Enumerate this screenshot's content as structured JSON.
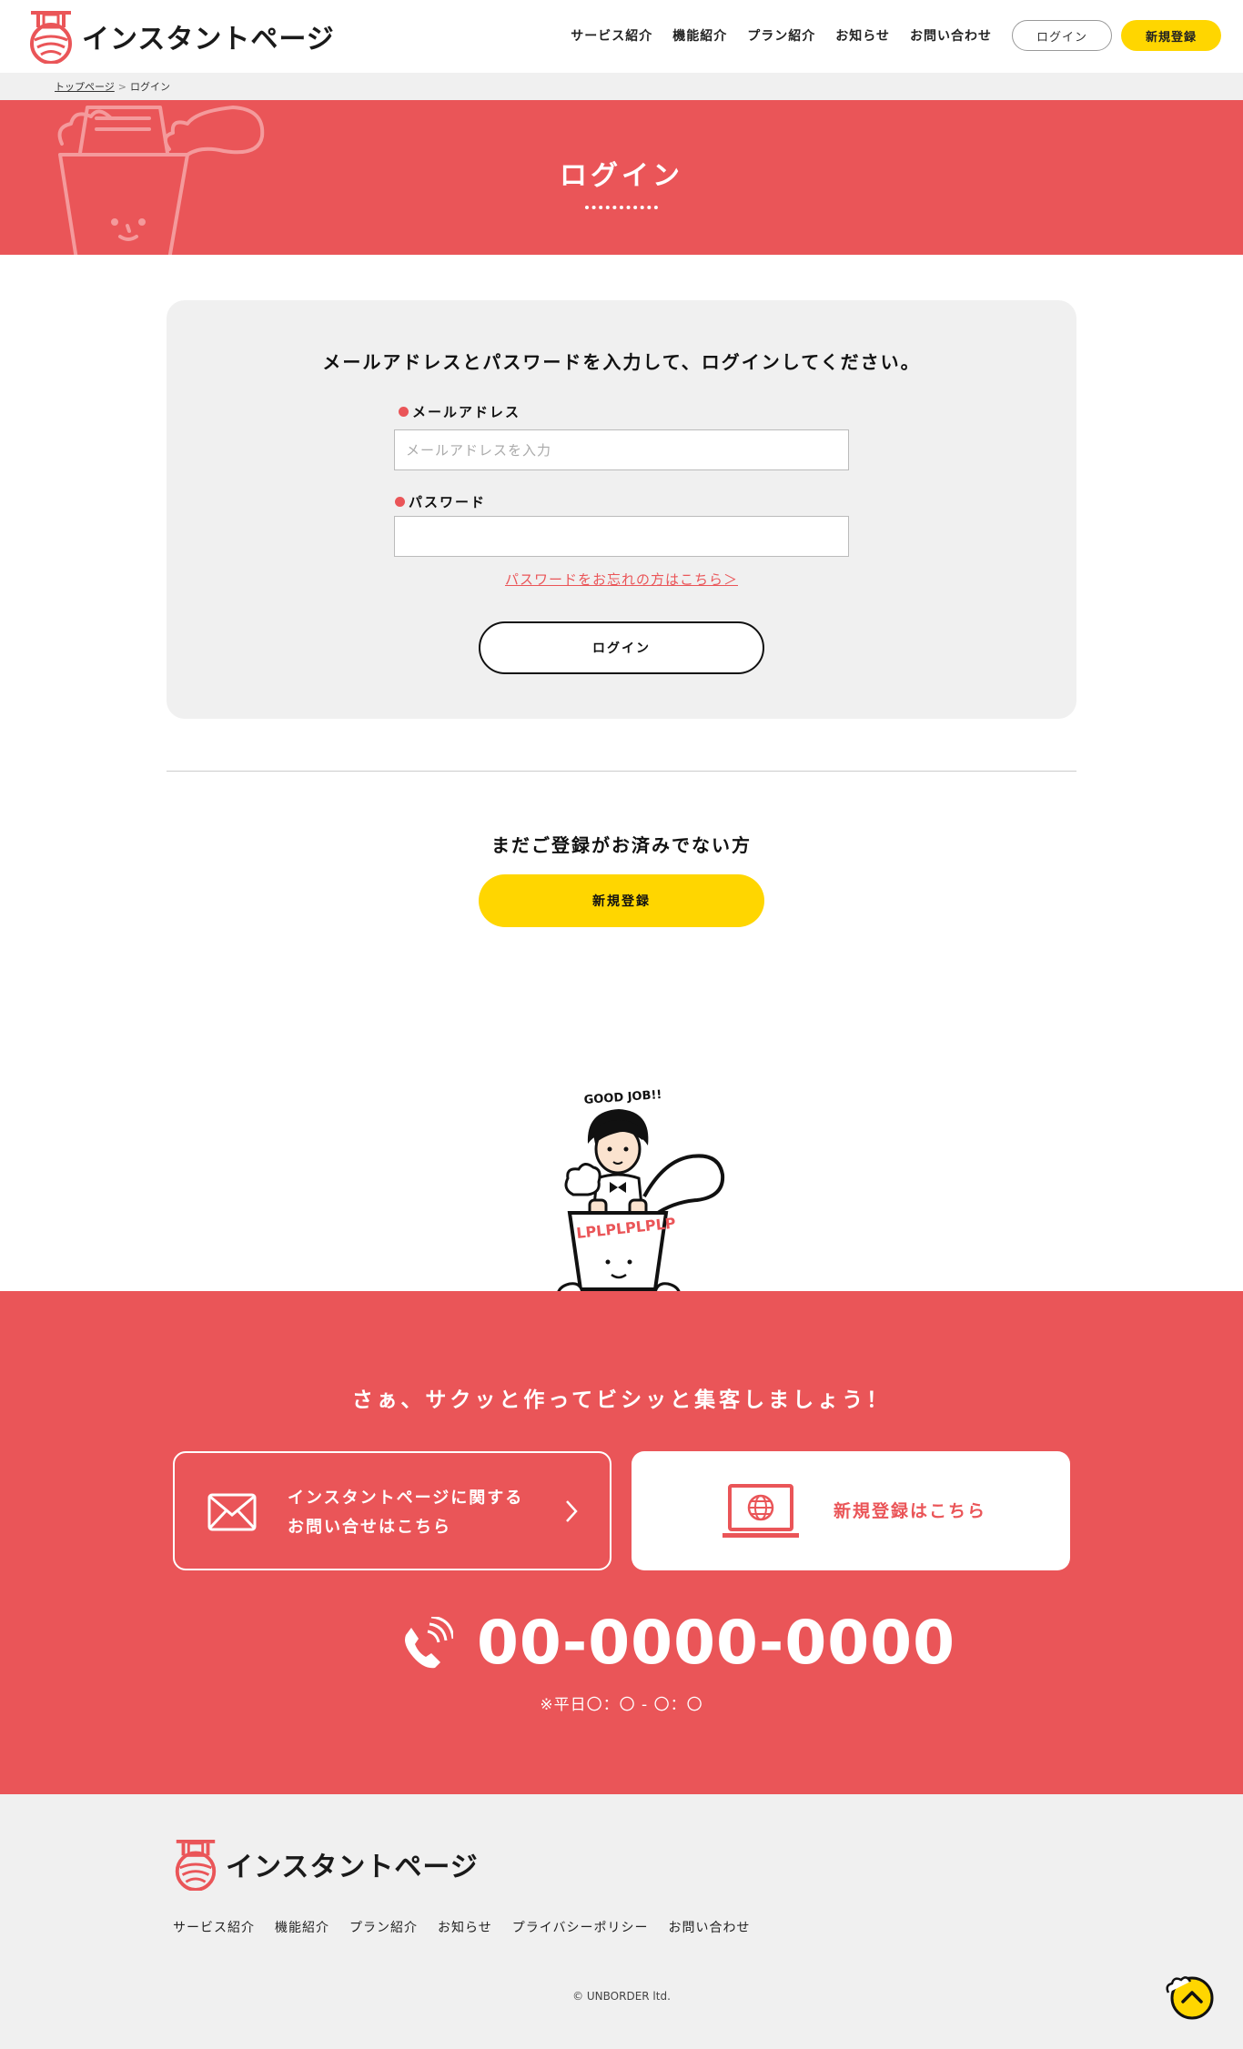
{
  "header": {
    "logo_text": "インスタントページ",
    "nav": [
      "サービス紹介",
      "機能紹介",
      "プラン紹介",
      "お知らせ",
      "お問い合わせ"
    ],
    "login_label": "ログイン",
    "register_label": "新規登録"
  },
  "breadcrumb": {
    "home": "トップページ",
    "separator": ">",
    "current": "ログイン"
  },
  "hero": {
    "title": "ログイン"
  },
  "login": {
    "lead": "メールアドレスとパスワードを入力して、ログインしてください。",
    "email_label": "メールアドレス",
    "email_placeholder": "メールアドレスを入力",
    "email_value": "",
    "password_label": "パスワード",
    "password_value": "",
    "forgot_link": "パスワードをお忘れの方はこちら＞",
    "submit_label": "ログイン"
  },
  "register": {
    "lead": "まだご登録がお済みでない方",
    "button_label": "新規登録"
  },
  "character": {
    "speech": "GOOD JOB!!",
    "cup_print": "LPLPLPLPLP"
  },
  "cta": {
    "lead": "さぁ、サクッと作ってビシッと集客しましょう！",
    "contact_line1": "インスタントページに関する",
    "contact_line2": "お問い合せはこちら",
    "register_text": "新規登録はこちら",
    "phone": "00-0000-0000",
    "hours": "※平日〇：〇 - 〇：〇"
  },
  "footer": {
    "logo_text": "インスタントページ",
    "nav": [
      "サービス紹介",
      "機能紹介",
      "プラン紹介",
      "お知らせ",
      "プライバシーポリシー",
      "お問い合わせ"
    ],
    "copyright": "© UNBORDER ltd."
  },
  "colors": {
    "accent_red": "#EA5558",
    "accent_yellow": "#FFD600",
    "panel_gray": "#f0f0f0"
  },
  "icons": [
    "logo-cup-icon",
    "mail-icon",
    "chevron-right-icon",
    "laptop-globe-icon",
    "phone-icon",
    "page-top-icon"
  ]
}
